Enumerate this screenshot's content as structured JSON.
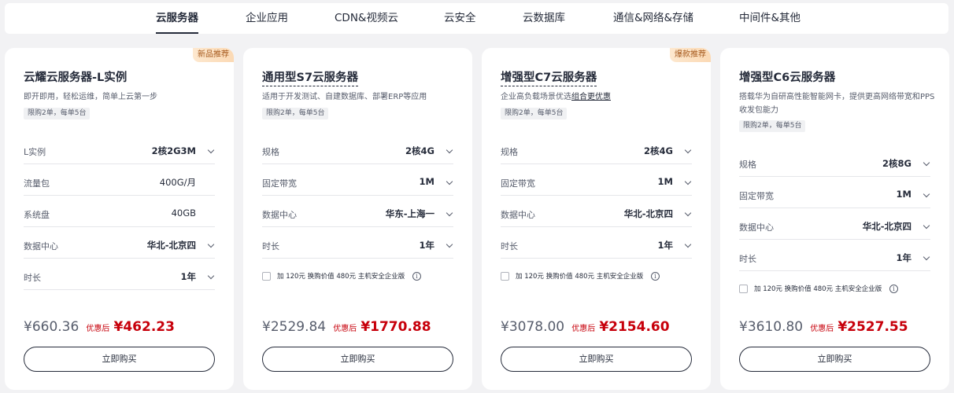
{
  "tabs": [
    {
      "label": "云服务器",
      "active": true
    },
    {
      "label": "企业应用",
      "active": false
    },
    {
      "label": "CDN&视频云",
      "active": false
    },
    {
      "label": "云安全",
      "active": false
    },
    {
      "label": "云数据库",
      "active": false
    },
    {
      "label": "通信&网络&存储",
      "active": false
    },
    {
      "label": "中间件&其他",
      "active": false
    }
  ],
  "cards": [
    {
      "badge": "新品推荐",
      "title": "云耀云服务器-L实例",
      "description": "即开即用，轻松运维，简单上云第一步",
      "limit": "限购2单，每单5台",
      "rows": [
        {
          "label": "L实例",
          "value": "2核2G3M",
          "selectable": true
        },
        {
          "label": "流量包",
          "value": "400G/月",
          "selectable": false
        },
        {
          "label": "系统盘",
          "value": "40GB",
          "selectable": false
        },
        {
          "label": "数据中心",
          "value": "华北-北京四",
          "selectable": true
        },
        {
          "label": "时长",
          "value": "1年",
          "selectable": true
        }
      ],
      "original_price": "¥660.36",
      "discount_label": "优惠后",
      "discount_price": "¥462.23",
      "buy_label": "立即购买"
    },
    {
      "title": "通用型S7云服务器",
      "description": "适用于开发测试、自建数据库、部署ERP等应用",
      "limit": "限购2单，每单5台",
      "rows": [
        {
          "label": "规格",
          "value": "2核4G",
          "selectable": true
        },
        {
          "label": "固定带宽",
          "value": "1M",
          "selectable": true
        },
        {
          "label": "数据中心",
          "value": "华东-上海一",
          "selectable": true
        },
        {
          "label": "时长",
          "value": "1年",
          "selectable": true
        }
      ],
      "addon": {
        "text": "加 120元 换购价值 480元 主机安全企业版",
        "checked": false
      },
      "original_price": "¥2529.84",
      "discount_label": "优惠后",
      "discount_price": "¥1770.88",
      "buy_label": "立即购买"
    },
    {
      "badge": "爆款推荐",
      "title": "增强型C7云服务器",
      "description": "企业高负载场景优选",
      "description_link": "组合更优惠",
      "limit": "限购2单，每单5台",
      "rows": [
        {
          "label": "规格",
          "value": "2核4G",
          "selectable": true
        },
        {
          "label": "固定带宽",
          "value": "1M",
          "selectable": true
        },
        {
          "label": "数据中心",
          "value": "华北-北京四",
          "selectable": true
        },
        {
          "label": "时长",
          "value": "1年",
          "selectable": true
        }
      ],
      "addon": {
        "text": "加 120元 换购价值 480元 主机安全企业版",
        "checked": false
      },
      "original_price": "¥3078.00",
      "discount_label": "优惠后",
      "discount_price": "¥2154.60",
      "buy_label": "立即购买"
    },
    {
      "title": "增强型C6云服务器",
      "description": "搭载华为自研高性能智能网卡，提供更高网络带宽和PPS收发包能力",
      "limit": "限购2单，每单5台",
      "rows": [
        {
          "label": "规格",
          "value": "2核8G",
          "selectable": true
        },
        {
          "label": "固定带宽",
          "value": "1M",
          "selectable": true
        },
        {
          "label": "数据中心",
          "value": "华北-北京四",
          "selectable": true
        },
        {
          "label": "时长",
          "value": "1年",
          "selectable": true
        }
      ],
      "addon": {
        "text": "加 120元 换购价值 480元 主机安全企业版",
        "checked": false
      },
      "original_price": "¥3610.80",
      "discount_label": "优惠后",
      "discount_price": "¥2527.55",
      "buy_label": "立即购买"
    }
  ]
}
